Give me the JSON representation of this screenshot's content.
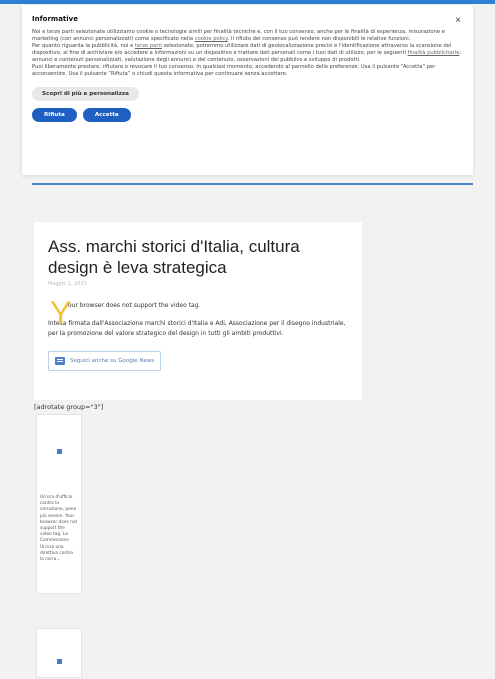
{
  "cookie": {
    "title": "Informative",
    "close": "×",
    "text_1": "Noi e terze parti selezionate utilizziamo cookie o tecnologie simili per finalità tecniche e, con il tuo consenso, anche per le finalità di esperienza, misurazione e marketing (con annunci personalizzati) come specificato nella",
    "policy_link": "cookie policy",
    "text_1b": ". Il rifiuto del consenso può rendere non disponibili le relative funzioni.",
    "text_2": "Per quanto riguarda la pubblicità, noi e",
    "third_link": "terze parti",
    "text_2b": "selezionate, potremmo utilizzare dati di geolocalizzazione precisi e l'identificazione attraverso la scansione del dispositivo, al fine di archiviare e/o accedere a informazioni su un dispositivo e trattare dati personali come i tuoi dati di utilizzo, per le seguenti",
    "purposes_link": "finalità pubblicitarie",
    "text_2c": ": annunci e contenuti personalizzati, valutazione degli annunci e del contenuto, osservazioni del pubblico e sviluppo di prodotti.",
    "text_3": "Puoi liberamente prestare, rifiutare o revocare il tuo consenso, in qualsiasi momento, accedendo al pannello delle preferenze. Usa il pulsante “Accetta” per acconsentire. Usa il pulsante “Rifiuta” o chiudi questa informativa per continuare senza accettare.",
    "more_button": "Scopri di più e personalizza",
    "reject_button": "Rifiuta",
    "accept_button": "Accetta"
  },
  "article": {
    "title": "Ass. marchi storici d'Italia, cultura design è leva strategica",
    "date": "Maggio 2, 2023",
    "dropcap": "Y",
    "video_text": "our browser does not support the video tag.",
    "body": "Intesa firmata dall'Associazione marchi storici d'Italia e Adi, Associazione per il disegno industriale, per la promozione del valore strategico del design in tutti gli ambiti produttivi.",
    "gnews_label": "Seguici anche su Google News"
  },
  "adrotate": "[adrotate group=\"3\"]",
  "cards": [
    {
      "text": "Un'ora d'ufficio contro la corruzione, pene più severe. Your browser does not support the video tag. La Commissione Un'ora una direttiva contro la corru..."
    },
    {
      "text": ""
    }
  ],
  "colors": {
    "accent": "#1f5fc2",
    "dropcap": "#f2c23a"
  }
}
